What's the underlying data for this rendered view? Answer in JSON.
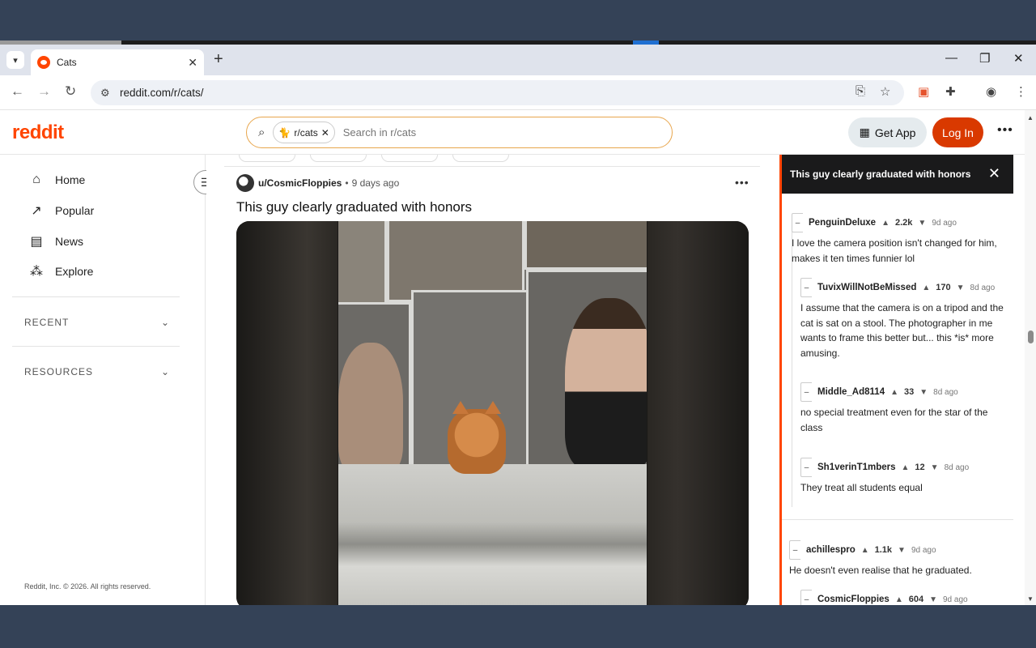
{
  "browser": {
    "tab_title": "Cats",
    "url": "reddit.com/r/cats/",
    "new_tab_label": "+"
  },
  "header": {
    "logo": "reddit",
    "search_chip": "r/cats",
    "search_placeholder": "Search in r/cats",
    "get_app": "Get App",
    "login": "Log In"
  },
  "sidebar": {
    "items": [
      {
        "label": "Home",
        "icon": "home-icon"
      },
      {
        "label": "Popular",
        "icon": "popular-icon"
      },
      {
        "label": "News",
        "icon": "news-icon"
      },
      {
        "label": "Explore",
        "icon": "explore-icon"
      }
    ],
    "sections": [
      "RECENT",
      "RESOURCES"
    ],
    "footer": "Reddit, Inc. © 2026. All rights reserved."
  },
  "post": {
    "author": "u/CosmicFloppies",
    "separator": "•",
    "age": "9 days ago",
    "title": "This guy clearly graduated with honors"
  },
  "comments_panel": {
    "title": "This guy clearly graduated with honors",
    "comments": [
      {
        "user": "PenguinDeluxe",
        "score": "2.2k",
        "ago": "9d ago",
        "text": "I love the camera position isn't changed for him, makes it ten times funnier lol"
      },
      {
        "user": "TuvixWillNotBeMissed",
        "score": "170",
        "ago": "8d ago",
        "text": "I assume that the camera is on a tripod and the cat is sat on a stool. The photographer in me wants to frame this better but... this *is* more amusing."
      },
      {
        "user": "Middle_Ad8114",
        "score": "33",
        "ago": "8d ago",
        "text": "no special treatment even for the star of the class"
      },
      {
        "user": "Sh1verinT1mbers",
        "score": "12",
        "ago": "8d ago",
        "text": "They treat all students equal"
      },
      {
        "user": "achillespro",
        "score": "1.1k",
        "ago": "9d ago",
        "text": "He doesn't even realise that he graduated."
      },
      {
        "user": "CosmicFloppies",
        "score": "604",
        "ago": "9d ago",
        "text": ""
      }
    ]
  },
  "colors": {
    "brand": "#ff4500",
    "login_bg": "#d93900",
    "desktop_bg": "#344257"
  }
}
